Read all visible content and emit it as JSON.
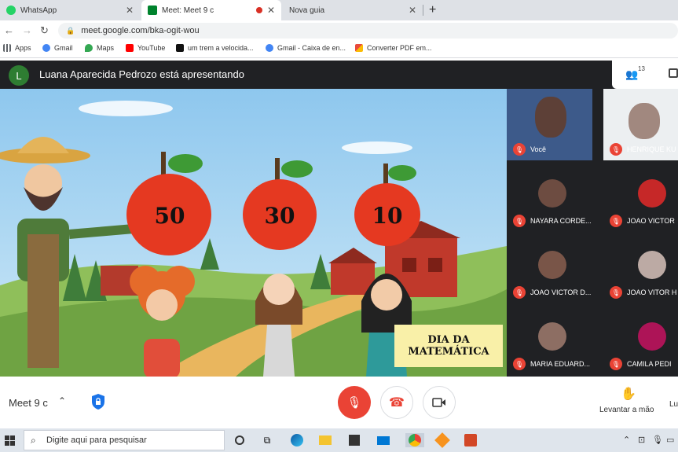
{
  "browser": {
    "tabs": [
      {
        "label": "WhatsApp",
        "color": "#25d366"
      },
      {
        "label": "Meet: Meet 9 c",
        "color": "#00832d"
      },
      {
        "label": "Nova guia",
        "color": ""
      }
    ],
    "new_tab": "+",
    "url": "meet.google.com/bka-ogit-wou",
    "bookmarks": [
      {
        "label": "Apps",
        "color": "#5f6368"
      },
      {
        "label": "Gmail",
        "color": "#4285f4"
      },
      {
        "label": "Maps",
        "color": "#34a853"
      },
      {
        "label": "YouTube",
        "color": "#ff0000"
      },
      {
        "label": "um trem a velocida...",
        "color": "#111111"
      },
      {
        "label": "Gmail - Caixa de en...",
        "color": "#4285f4"
      },
      {
        "label": "Converter PDF em...",
        "color": "#e94b3c"
      }
    ]
  },
  "meet": {
    "avatar_letter": "L",
    "presenting": "Luana Aparecida Pedrozo está apresentando",
    "people_count": "13",
    "slide": {
      "apples": [
        "50",
        "30",
        "10"
      ],
      "caption_line1": "DIA DA",
      "caption_line2": "MATEMÁTICA"
    },
    "participants": [
      {
        "name": "Você",
        "color": "#5d4037"
      },
      {
        "name": "HENRIQUE KU",
        "color": "#a1887f"
      },
      {
        "name": "NAYARA CORDE...",
        "color": "#6d4c41"
      },
      {
        "name": "JOAO VICTOR",
        "color": "#c62828"
      },
      {
        "name": "JOAO VICTOR D...",
        "color": "#795548"
      },
      {
        "name": "JOAO VITOR H",
        "color": "#bcaaa4"
      },
      {
        "name": "MARIA EDUARD...",
        "color": "#8d6e63"
      },
      {
        "name": "CAMILA PEDI",
        "color": "#ad1457"
      }
    ],
    "meeting_name": "Meet 9 c",
    "raise_hand": "Levantar a mão",
    "more_label": "Lu"
  },
  "taskbar": {
    "search_placeholder": "Digite aqui para pesquisar"
  }
}
